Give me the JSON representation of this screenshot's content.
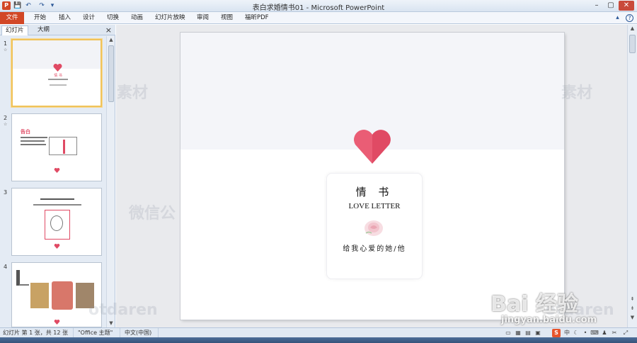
{
  "window": {
    "title": "表白求婚情书01 - Microsoft PowerPoint",
    "app_icon": "P",
    "controls": {
      "minimize": "–",
      "maximize": "▢",
      "close": "✕"
    }
  },
  "quick_access": {
    "save": "💾",
    "undo": "↶",
    "redo": "↷",
    "customize": "▾"
  },
  "ribbon": {
    "tabs": [
      "文件",
      "开始",
      "插入",
      "设计",
      "切换",
      "动画",
      "幻灯片放映",
      "审阅",
      "视图",
      "福昕PDF"
    ],
    "collapse_icon": "▴",
    "help_icon": "?"
  },
  "left_pane": {
    "tabs": [
      "幻灯片",
      "大纲"
    ],
    "close": "×",
    "thumbnails": [
      {
        "number": "1",
        "label": "情 书"
      },
      {
        "number": "2",
        "label": "告白"
      },
      {
        "number": "3",
        "label": ""
      },
      {
        "number": "4",
        "label": ""
      }
    ]
  },
  "slide": {
    "title_cn": "情 书",
    "title_en": "LOVE LETTER",
    "subtitle": "给我心爱的她/他",
    "colors": {
      "heart": "#e04a64",
      "band": "#f4f5f9"
    }
  },
  "statusbar": {
    "slide_info": "幻灯片 第 1 张，共 12 张",
    "theme": "\"Office 主题\"",
    "language": "中文(中国)",
    "ime_label": "S"
  },
  "watermarks": {
    "wm1": "素材",
    "wm2": "素材",
    "wm3": "微信公",
    "wm4": "otdaren",
    "wm5": "otdaren",
    "baidu_logo": "Bai 经验",
    "baidu_url": "jingyan.baidu.com"
  }
}
